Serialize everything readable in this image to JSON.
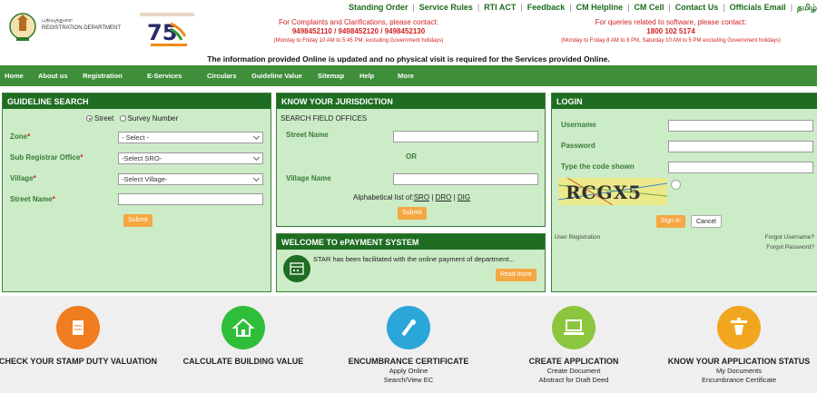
{
  "header": {
    "logo_text_line1": "பதிவுத்துறை",
    "logo_text_line2": "REGISTRATION DEPARTMENT",
    "top_links": [
      "Standing Order",
      "Service Rules",
      "RTI ACT",
      "Feedback",
      "CM Helpline",
      "CM Cell",
      "Contact Us",
      "Officials Email",
      "தமிழ்"
    ],
    "contact_left": {
      "line1": "For Complaints and Clarifications, please contact:",
      "phones": "9498452110 / 9498452120 / 9498452130",
      "hours": "(Monday to Friday 10 AM to 5:45 PM, excluding Government holidays)"
    },
    "contact_right": {
      "line1": "For queries related to software, please contact:",
      "phones": "1800 102 5174",
      "hours": "(Monday to Friday 8 AM to 8 PM, Saturday 10 AM to 5 PM excluding Government holidays)"
    },
    "notice": "The information provided Online is updated and no physical visit is required for the Services provided Online."
  },
  "nav": [
    "Home",
    "About us",
    "Registration",
    "E-Services",
    "Circulars",
    "Guideline Value",
    "Sitemap",
    "Help",
    "More"
  ],
  "guideline": {
    "title": "GUIDELINE SEARCH",
    "radio_street": "Street",
    "radio_survey": "Survey Number",
    "zone_label": "Zone",
    "zone_value": "- Select -",
    "sro_label": "Sub Registrar Office",
    "sro_value": "-Select SRO-",
    "village_label": "Village",
    "village_value": "-Select Village-",
    "street_label": "Street Name",
    "submit": "Submit"
  },
  "jurisdiction": {
    "title": "KNOW YOUR JURISDICTION",
    "subtitle": "SEARCH FIELD OFFICES",
    "street_label": "Street Name",
    "or": "OR",
    "village_label": "Village Name",
    "alpha_prefix": "Alphabetical list of:",
    "link_sro": "SRO",
    "link_dro": "DRO",
    "link_dig": "DIG",
    "submit": "Submit"
  },
  "epayment": {
    "title": "WELCOME TO ePAYMENT SYSTEM",
    "text": "STAR has been facilitated with the online payment of department...",
    "read_more": "Read more"
  },
  "login": {
    "title": "LOGIN",
    "username_label": "Username",
    "password_label": "Password",
    "captcha_label": "Type the code shown",
    "captcha_text": "RCGX5",
    "sign_in": "Sign In",
    "cancel": "Cancel",
    "user_registration": "User Registration",
    "forgot_username": "Forgot Username?",
    "forgot_password": "Forgot Password?"
  },
  "cards": [
    {
      "title": "CHECK YOUR STAMP DUTY VALUATION",
      "sub1": "",
      "sub2": "",
      "color": "#f07d1f",
      "icon": "document-icon"
    },
    {
      "title": "CALCULATE BUILDING VALUE",
      "sub1": "",
      "sub2": "",
      "color": "#2fbe3a",
      "icon": "home-icon"
    },
    {
      "title": "ENCUMBRANCE CERTIFICATE",
      "sub1": "Apply Online",
      "sub2": "Search/View EC",
      "color": "#2aa6d8",
      "icon": "certificate-icon"
    },
    {
      "title": "CREATE APPLICATION",
      "sub1": "Create Document",
      "sub2": "Abstract for Draft Deed",
      "color": "#8cc63e",
      "icon": "laptop-icon"
    },
    {
      "title": "KNOW YOUR APPLICATION STATUS",
      "sub1": "My Documents",
      "sub2": "Encumbrance Certificate",
      "color": "#f2a61f",
      "icon": "status-icon"
    }
  ]
}
